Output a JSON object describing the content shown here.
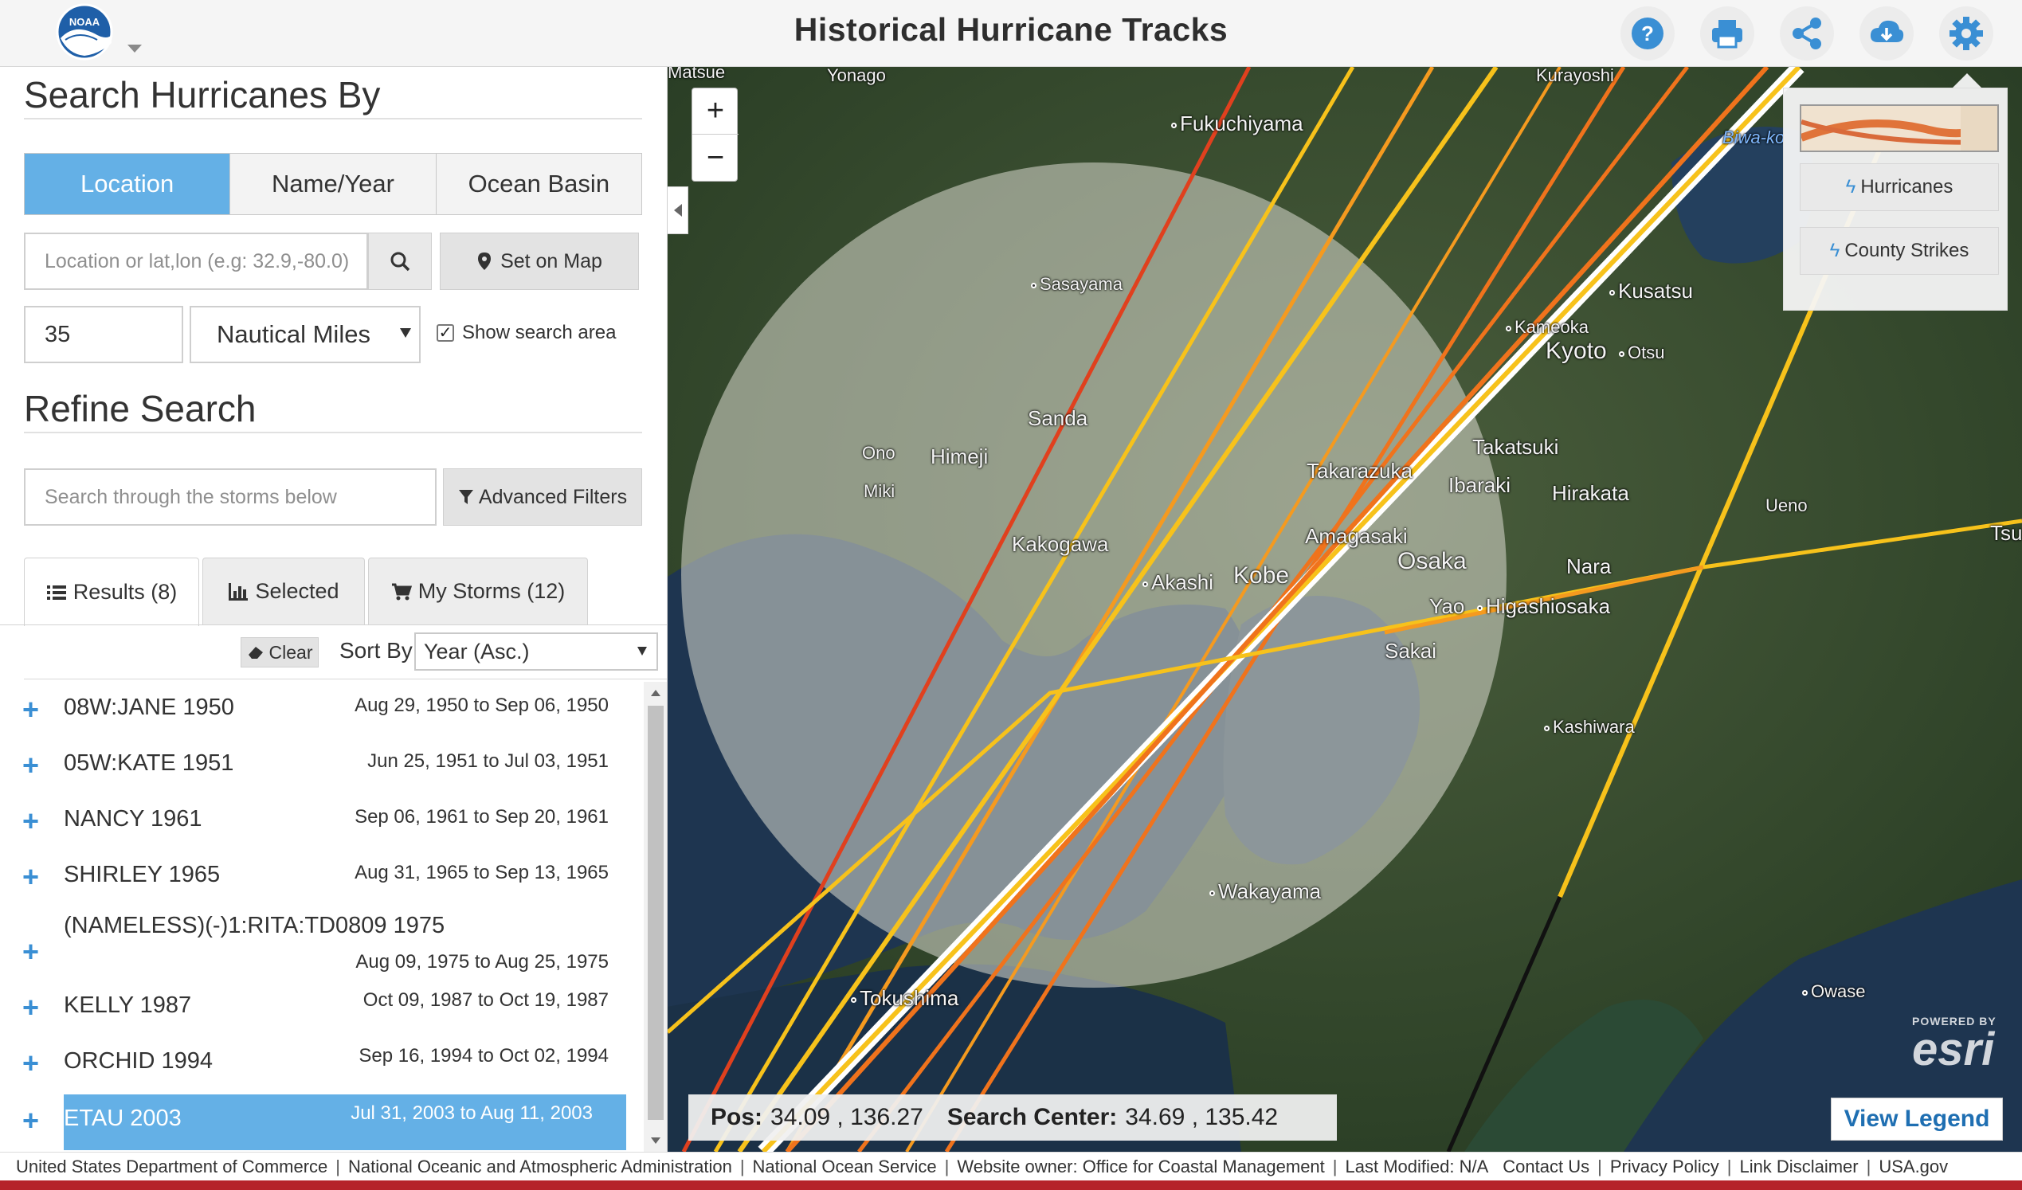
{
  "header": {
    "title": "Historical Hurricane Tracks",
    "logo_text": "NOAA",
    "buttons": [
      "help-icon",
      "print-icon",
      "share-icon",
      "download-icon",
      "settings-icon"
    ]
  },
  "search_by": {
    "title": "Search Hurricanes By",
    "tabs": [
      {
        "label": "Location",
        "active": true
      },
      {
        "label": "Name/Year",
        "active": false
      },
      {
        "label": "Ocean Basin",
        "active": false
      }
    ],
    "location_placeholder": "Location or lat,lon (e.g: 32.9,-80.0)",
    "set_on_map": "Set on Map",
    "radius_value": "35",
    "radius_unit": "Nautical Miles",
    "show_search_area": "Show search area",
    "show_search_area_checked": true
  },
  "refine": {
    "title": "Refine Search",
    "filter_placeholder": "Search through the storms below",
    "advanced_filters": "Advanced Filters"
  },
  "result_tabs": [
    {
      "label": "Results (8)",
      "icon": "list-icon",
      "active": true
    },
    {
      "label": "Selected",
      "icon": "bar-chart-icon",
      "active": false
    },
    {
      "label": "My Storms (12)",
      "icon": "cart-icon",
      "active": false
    }
  ],
  "list_controls": {
    "clear": "Clear",
    "sort_by": "Sort By",
    "sort_value": "Year (Asc.)"
  },
  "storms": [
    {
      "name": "08W:JANE 1950",
      "dates": "Aug 29, 1950 to Sep 06, 1950",
      "selected": false
    },
    {
      "name": "05W:KATE 1951",
      "dates": "Jun 25, 1951 to Jul 03, 1951",
      "selected": false
    },
    {
      "name": "NANCY 1961",
      "dates": "Sep 06, 1961 to Sep 20, 1961",
      "selected": false
    },
    {
      "name": "SHIRLEY 1965",
      "dates": "Aug 31, 1965 to Sep 13, 1965",
      "selected": false
    },
    {
      "name": "(NAMELESS)(-)1:RITA:TD0809 1975",
      "dates": "Aug 09, 1975 to Aug 25, 1975",
      "selected": false
    },
    {
      "name": "KELLY 1987",
      "dates": "Oct 09, 1987 to Oct 19, 1987",
      "selected": false
    },
    {
      "name": "ORCHID 1994",
      "dates": "Sep 16, 1994 to Oct 02, 1994",
      "selected": false
    },
    {
      "name": "ETAU 2003",
      "dates": "Jul 31, 2003 to Aug 11, 2003",
      "selected": true
    }
  ],
  "map": {
    "cities": [
      "Fukuchiyama",
      "Sasayama",
      "Kusatsu",
      "Kameoka",
      "Kyoto",
      "Otsu",
      "Sanda",
      "Himeji",
      "Ono",
      "Miki",
      "Takarazuka",
      "Takatsuki",
      "Ibaraki",
      "Hirakata",
      "Kakogawa",
      "Amagasaki",
      "Osaka",
      "Nara",
      "Ueno",
      "Akashi",
      "Kobe",
      "Yao",
      "Higashiosaka",
      "Sakai",
      "Kashiwara",
      "Wakayama",
      "Tokushima",
      "Owase",
      "Biwa-ko",
      "Tsu",
      "Matsue",
      "Yonago",
      "Kurayoshi"
    ],
    "layers": [
      {
        "label": "Hurricanes",
        "icon": "hurricane-icon"
      },
      {
        "label": "County Strikes",
        "icon": "strike-icon"
      }
    ],
    "position_label": "Pos:",
    "position_value": "34.09 , 136.27",
    "search_center_label": "Search Center:",
    "search_center_value": "34.69 , 135.42",
    "powered_by": "POWERED BY",
    "esri": "esri",
    "view_legend": "View Legend",
    "track_colors": {
      "category_1": "#f7c21b",
      "category_2": "#f59a1f",
      "category_3": "#f0731c",
      "category_4": "#e0401e",
      "extratropical": "#111111",
      "selected": "#ffffff"
    }
  },
  "footer": {
    "items": [
      "United States Department of Commerce",
      "National Oceanic and Atmospheric Administration",
      "National Ocean Service",
      "Website owner: Office for Coastal Management",
      "Last Modified: N/A"
    ],
    "links": [
      "Contact Us",
      "Privacy Policy",
      "Link Disclaimer",
      "USA.gov"
    ]
  }
}
